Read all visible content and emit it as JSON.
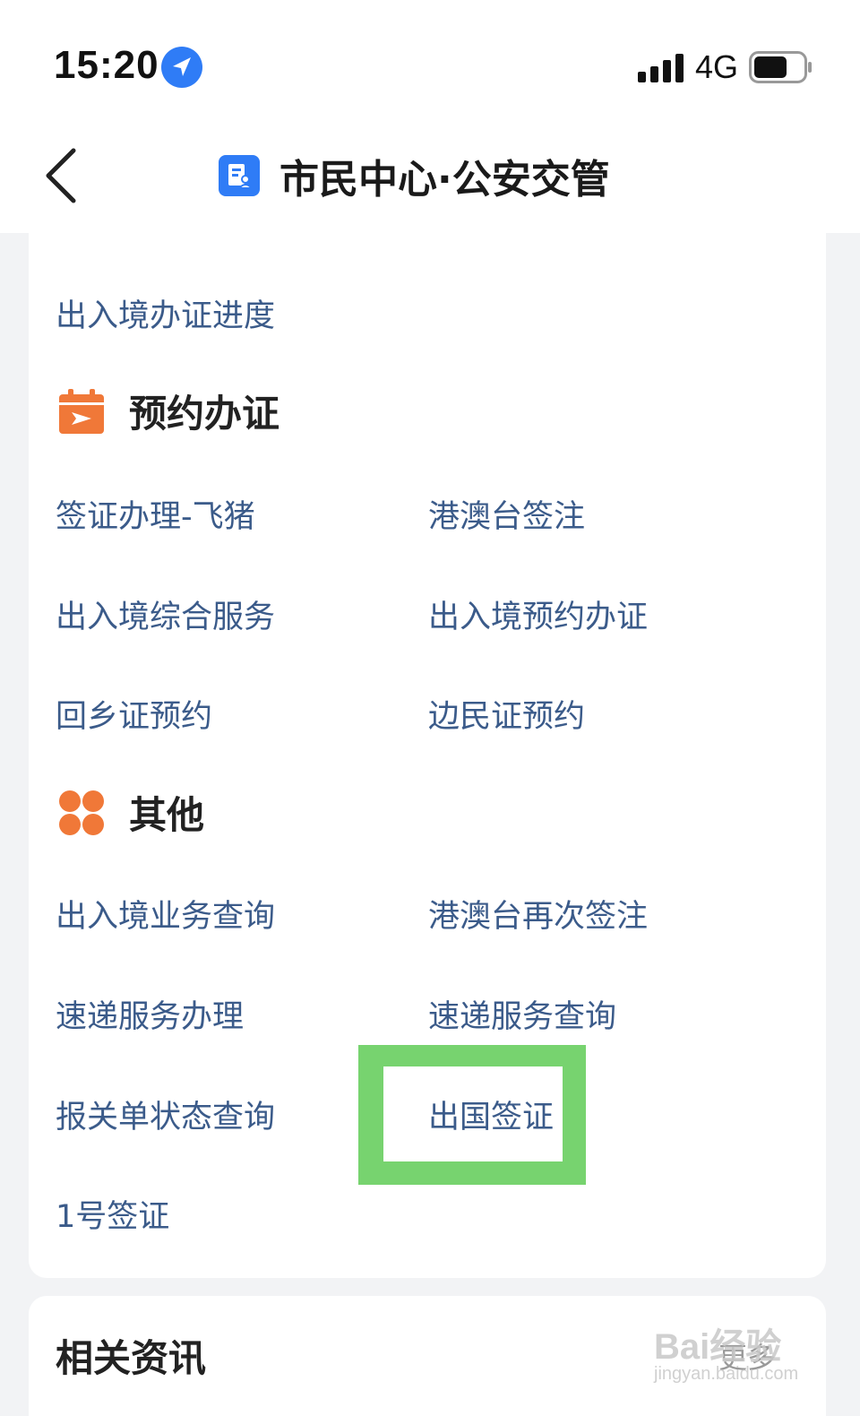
{
  "status_bar": {
    "time": "15:20",
    "network": "4G"
  },
  "nav": {
    "title": "市民中心·公安交管"
  },
  "top_link": "出入境办证进度",
  "sections": [
    {
      "title": "预约办证",
      "icon": "calendar-plane-icon",
      "items": [
        "签证办理-飞猪",
        "港澳台签注",
        "出入境综合服务",
        "出入境预约办证",
        "回乡证预约",
        "边民证预约"
      ]
    },
    {
      "title": "其他",
      "icon": "four-petal-grid-icon",
      "items": [
        "出入境业务查询",
        "港澳台再次签注",
        "速递服务办理",
        "速递服务查询",
        "报关单状态查询",
        "出国签证",
        "1号签证"
      ]
    }
  ],
  "news": {
    "title": "相关资讯",
    "more": "更多"
  },
  "watermark": {
    "main": "Bai经验",
    "sub": "jingyan.baidu.com"
  },
  "colors": {
    "link": "#3b5b8a",
    "accent_orange": "#f07838",
    "brand_blue": "#2f7cf6",
    "highlight_green": "#77d36f"
  }
}
